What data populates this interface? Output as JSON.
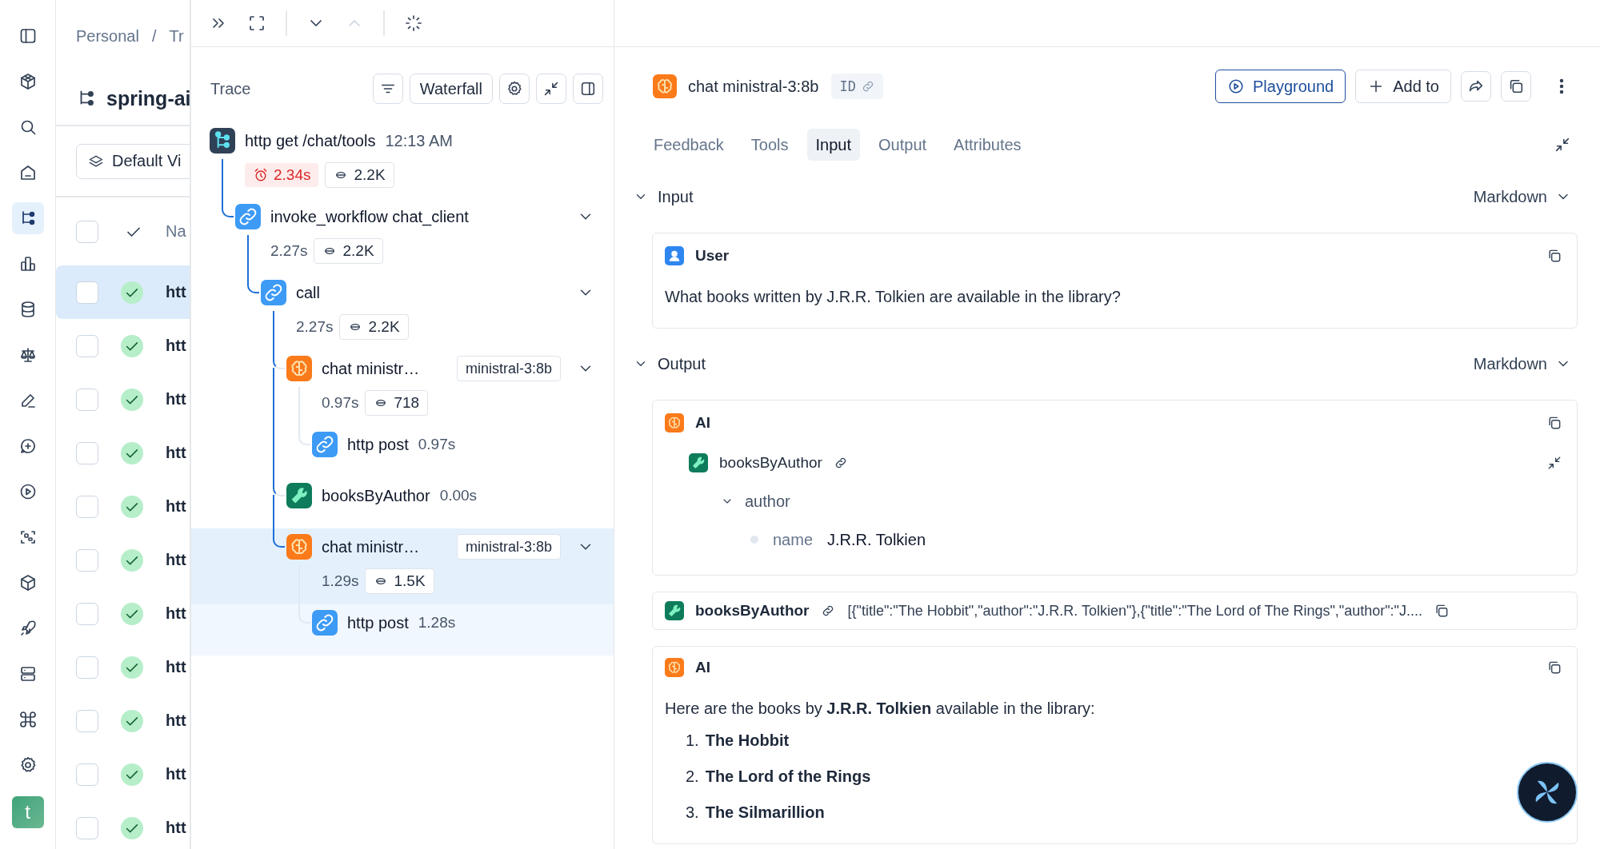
{
  "rail": {
    "items": [
      {
        "selected": false
      },
      {
        "selected": false
      },
      {
        "selected": false
      },
      {
        "selected": false
      },
      {
        "selected": true
      },
      {
        "selected": false
      },
      {
        "selected": false
      },
      {
        "selected": false
      },
      {
        "selected": false
      },
      {
        "selected": false
      },
      {
        "selected": false
      },
      {
        "selected": false
      },
      {
        "selected": false
      },
      {
        "selected": false
      },
      {
        "selected": false
      },
      {
        "selected": false
      },
      {
        "selected": false
      }
    ],
    "avatar": "t"
  },
  "list": {
    "breadcrumb": [
      "Personal",
      "/",
      "Tr"
    ],
    "title": "spring-ai",
    "view_button": "Default Vi",
    "header": {
      "all_selected": false,
      "column_3": "Na"
    },
    "rows": [
      {
        "name": "htt",
        "selected": true,
        "succeeded": true
      },
      {
        "name": "htt",
        "selected": false,
        "succeeded": true
      },
      {
        "name": "htt",
        "selected": false,
        "succeeded": true
      },
      {
        "name": "htt",
        "selected": false,
        "succeeded": true
      },
      {
        "name": "htt",
        "selected": false,
        "succeeded": true
      },
      {
        "name": "htt",
        "selected": false,
        "succeeded": true
      },
      {
        "name": "htt",
        "selected": false,
        "succeeded": true
      },
      {
        "name": "htt",
        "selected": false,
        "succeeded": true
      },
      {
        "name": "htt",
        "selected": false,
        "succeeded": true
      },
      {
        "name": "htt",
        "selected": false,
        "succeeded": true
      },
      {
        "name": "htt",
        "selected": false,
        "succeeded": true
      }
    ]
  },
  "trace": {
    "nav": {
      "prev_disabled": true
    },
    "title": "Trace",
    "view_button": "Waterfall",
    "spans": [
      {
        "kind": "trace",
        "name": "http get /chat/tools",
        "time": "12:13 AM",
        "duration": "2.34s",
        "duration_alert": true,
        "tokens": "2.2K",
        "selected": false,
        "hovered": false,
        "children": [
          {
            "kind": "chain",
            "name": "invoke_workflow chat_client",
            "duration": "2.27s",
            "duration_alert": false,
            "tokens": "2.2K",
            "expanded": true,
            "selected": false,
            "hovered": false,
            "children": [
              {
                "kind": "chain",
                "name": "call",
                "duration": "2.27s",
                "duration_alert": false,
                "tokens": "2.2K",
                "expanded": true,
                "selected": false,
                "hovered": false,
                "children": [
                  {
                    "kind": "llm",
                    "name": "chat ministr…",
                    "model": "ministral-3:8b",
                    "duration": "0.97s",
                    "duration_alert": false,
                    "tokens": "718",
                    "expanded": true,
                    "selected": false,
                    "hovered": false,
                    "children": [
                      {
                        "kind": "chain",
                        "name": "http post",
                        "duration": "0.97s",
                        "duration_alert": false,
                        "selected": false,
                        "hovered": false
                      }
                    ]
                  },
                  {
                    "kind": "tool",
                    "name": "booksByAuthor",
                    "duration": "0.00s",
                    "duration_alert": false,
                    "selected": false,
                    "hovered": false
                  },
                  {
                    "kind": "llm",
                    "name": "chat ministr…",
                    "model": "ministral-3:8b",
                    "duration": "1.29s",
                    "duration_alert": false,
                    "tokens": "1.5K",
                    "expanded": true,
                    "selected": true,
                    "hovered": false,
                    "children": [
                      {
                        "kind": "chain",
                        "name": "http post",
                        "duration": "1.28s",
                        "duration_alert": false,
                        "selected": false,
                        "hovered": true
                      }
                    ]
                  }
                ]
              }
            ]
          }
        ]
      }
    ]
  },
  "detail": {
    "title": "chat ministral-3:8b",
    "id_label": "ID",
    "playground_button": "Playground",
    "add_button": "Add to",
    "tabs": [
      {
        "label": "Feedback",
        "selected": false
      },
      {
        "label": "Tools",
        "selected": false
      },
      {
        "label": "Input",
        "selected": true
      },
      {
        "label": "Output",
        "selected": false
      },
      {
        "label": "Attributes",
        "selected": false
      }
    ],
    "sections": [
      {
        "title": "Input",
        "format": "Markdown",
        "expanded": true,
        "messages": [
          {
            "kind": "user",
            "role": "User",
            "text": "What books written by J.R.R. Tolkien are available in the library?"
          }
        ]
      },
      {
        "title": "Output",
        "format": "Markdown",
        "expanded": true,
        "messages": [
          {
            "kind": "ai",
            "role": "AI",
            "tool_call": {
              "name": "booksByAuthor",
              "args": [
                {
                  "key": "author",
                  "expanded": true,
                  "children": [
                    {
                      "key": "name",
                      "value": "J.R.R. Tolkien"
                    }
                  ]
                }
              ]
            }
          },
          {
            "kind": "tool",
            "role": "booksByAuthor",
            "text": "[{\"title\":\"The Hobbit\",\"author\":\"J.R.R. Tolkien\"},{\"title\":\"The Lord of The Rings\",\"author\":\"J...."
          },
          {
            "kind": "ai",
            "role": "AI",
            "text": "Here are the books by **J.R.R. Tolkien** available in the library:",
            "list": [
              {
                "number": "1.",
                "text": "The Hobbit"
              },
              {
                "number": "2.",
                "text": "The Lord of the Rings"
              },
              {
                "number": "3.",
                "text": "The Silmarillion"
              }
            ]
          }
        ]
      }
    ]
  }
}
